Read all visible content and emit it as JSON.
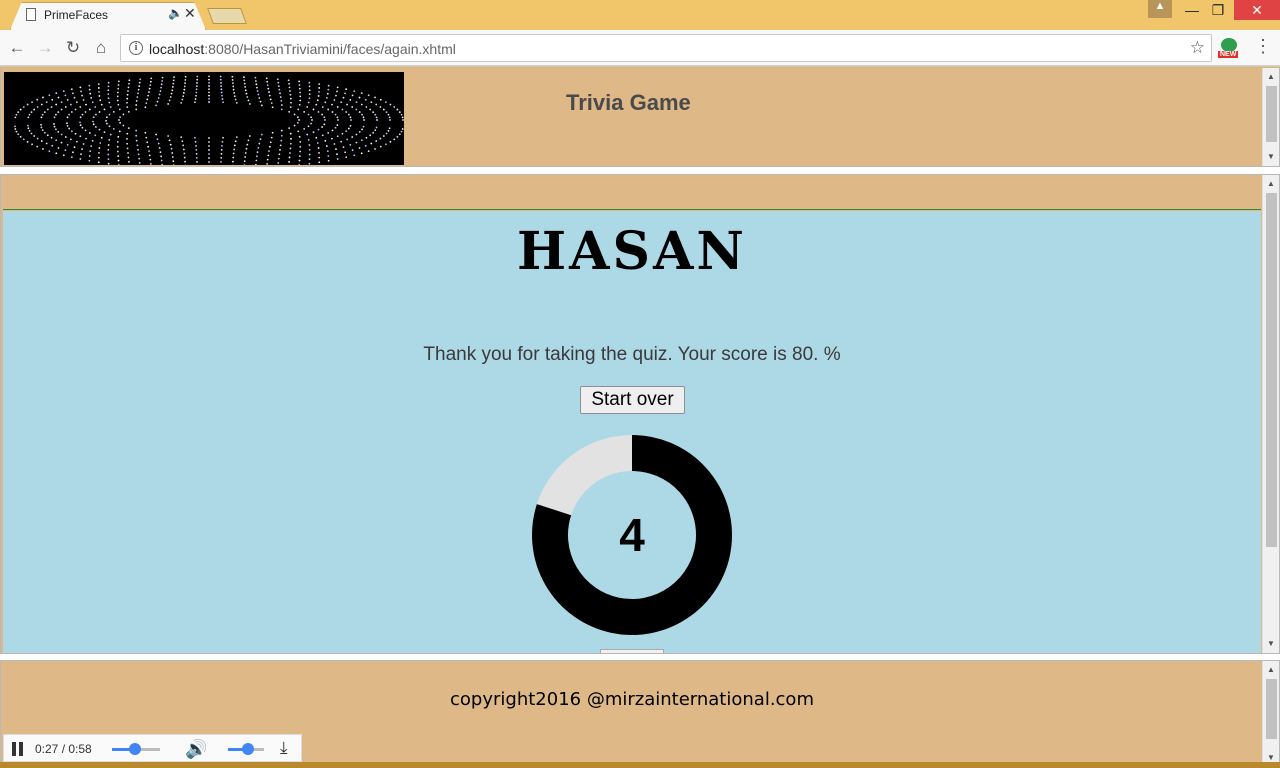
{
  "browser": {
    "tab_title": "PrimeFaces",
    "url_host": "localhost",
    "url_rest": ":8080/HasanTriviamini/faces/again.xhtml",
    "ext_badge": "NEW"
  },
  "header": {
    "title": "Trivia Game"
  },
  "main": {
    "player_name": "HASAN",
    "score_message": "Thank you for taking the quiz. Your score is 80. %",
    "start_over_label": "Start over",
    "countdown": {
      "value_label": "4",
      "elapsed_fraction": 0.2
    }
  },
  "footer": {
    "copyright": "copyright2016 @mirzainternational.com"
  },
  "media": {
    "time": "0:27 / 0:58",
    "progress": 0.47,
    "volume": 0.55
  },
  "colors": {
    "frame_tan": "#deb887",
    "content_blue": "#add8e6",
    "timer_black": "#000000",
    "timer_track": "#e2e2e2"
  }
}
